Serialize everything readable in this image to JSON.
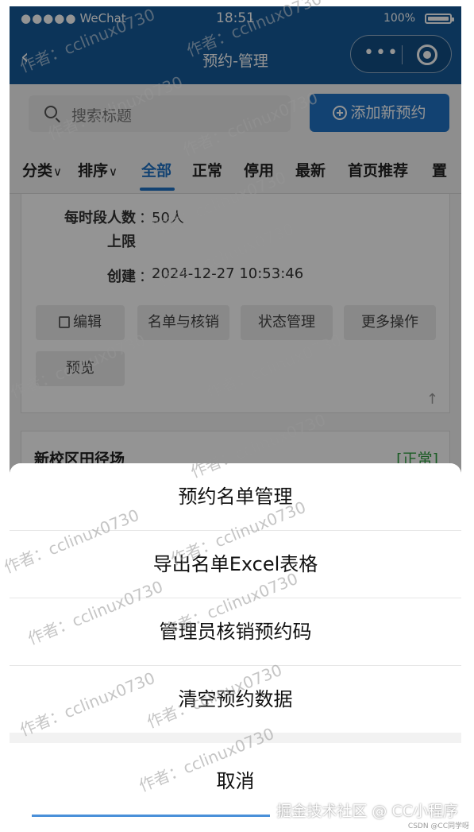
{
  "status_bar": {
    "signal": "●●●●●",
    "carrier": "WeChat",
    "time": "18:51",
    "battery": "100%"
  },
  "nav": {
    "title": "预约-管理",
    "back_glyph": "‹",
    "capsule_menu": "•••"
  },
  "search": {
    "placeholder": "搜索标题",
    "add_button": "添加新预约"
  },
  "filters": {
    "items": [
      "分类",
      "排序",
      "全部",
      "正常",
      "停用",
      "最新",
      "首页推荐",
      "置"
    ],
    "active": "全部"
  },
  "card": {
    "fields": [
      {
        "label_line1": "每时段人数",
        "label_line2": "上限",
        "value": "50人"
      },
      {
        "label": "创建",
        "value": "2024-12-27 10:53:46"
      }
    ],
    "actions": [
      "编辑",
      "名单与核销",
      "状态管理",
      "更多操作",
      "预览"
    ]
  },
  "card2": {
    "title": "新校区田径场",
    "status": "[正常]"
  },
  "action_sheet": {
    "items": [
      "预约名单管理",
      "导出名单Excel表格",
      "管理员核销预约码",
      "清空预约数据"
    ],
    "cancel": "取消"
  },
  "watermark": "作者：cclinux0730",
  "footer": {
    "platform": "掘金技术社区 @ CC小程序",
    "small": "CSDN @CC同学呀"
  },
  "colors": {
    "nav": "#155a99",
    "accent": "#1f72c4",
    "status_ok": "#2e9e3e"
  }
}
